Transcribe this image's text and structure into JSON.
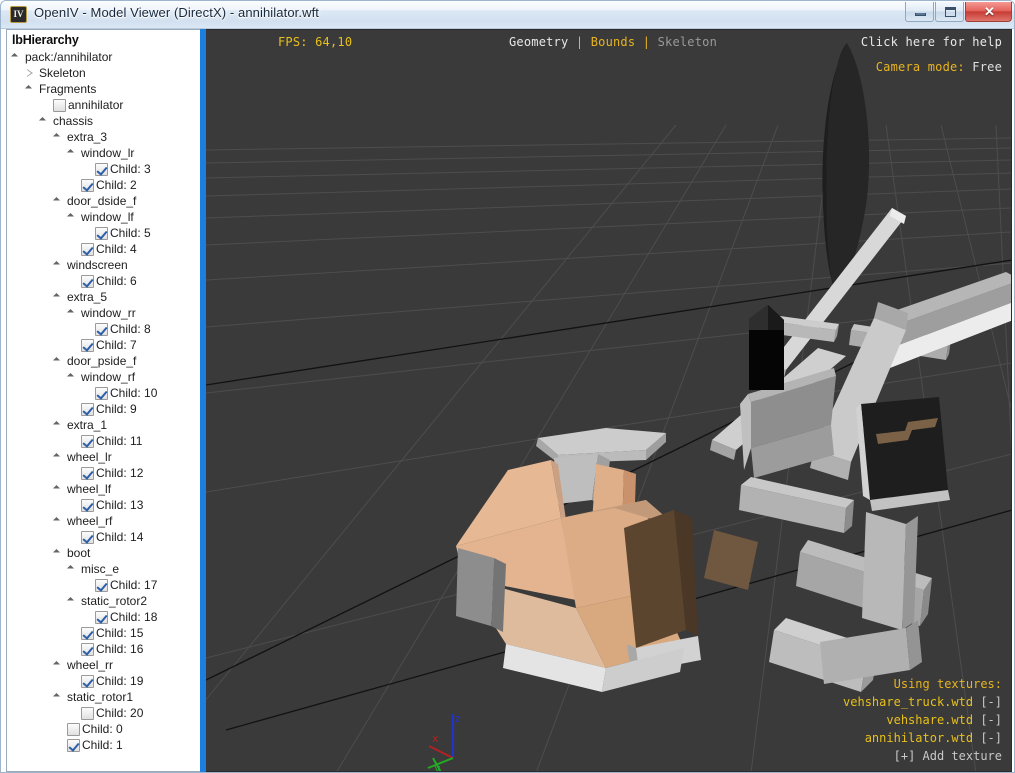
{
  "window": {
    "title": "OpenIV - Model Viewer (DirectX) - annihilator.wft",
    "icon": "openiv-app-icon",
    "minimize_label": "–",
    "maximize_label": "❐",
    "close_label": "✕"
  },
  "sidebar": {
    "header": "lbHierarchy",
    "items": [
      {
        "label": "pack:/annihilator",
        "depth": 0,
        "node": "open",
        "checkbox": null
      },
      {
        "label": "Skeleton",
        "depth": 1,
        "node": "closed",
        "checkbox": null
      },
      {
        "label": "Fragments",
        "depth": 1,
        "node": "open",
        "checkbox": null
      },
      {
        "label": "annihilator",
        "depth": 3,
        "node": "none",
        "checkbox": "unchecked"
      },
      {
        "label": "chassis",
        "depth": 2,
        "node": "open",
        "checkbox": null
      },
      {
        "label": "extra_3",
        "depth": 3,
        "node": "open",
        "checkbox": null
      },
      {
        "label": "window_lr",
        "depth": 4,
        "node": "open",
        "checkbox": null
      },
      {
        "label": "Child: 3",
        "depth": 6,
        "node": "none",
        "checkbox": "checked"
      },
      {
        "label": "Child: 2",
        "depth": 5,
        "node": "none",
        "checkbox": "checked"
      },
      {
        "label": "door_dside_f",
        "depth": 3,
        "node": "open",
        "checkbox": null
      },
      {
        "label": "window_lf",
        "depth": 4,
        "node": "open",
        "checkbox": null
      },
      {
        "label": "Child: 5",
        "depth": 6,
        "node": "none",
        "checkbox": "checked"
      },
      {
        "label": "Child: 4",
        "depth": 5,
        "node": "none",
        "checkbox": "checked"
      },
      {
        "label": "windscreen",
        "depth": 3,
        "node": "open",
        "checkbox": null
      },
      {
        "label": "Child: 6",
        "depth": 5,
        "node": "none",
        "checkbox": "checked"
      },
      {
        "label": "extra_5",
        "depth": 3,
        "node": "open",
        "checkbox": null
      },
      {
        "label": "window_rr",
        "depth": 4,
        "node": "open",
        "checkbox": null
      },
      {
        "label": "Child: 8",
        "depth": 6,
        "node": "none",
        "checkbox": "checked"
      },
      {
        "label": "Child: 7",
        "depth": 5,
        "node": "none",
        "checkbox": "checked"
      },
      {
        "label": "door_pside_f",
        "depth": 3,
        "node": "open",
        "checkbox": null
      },
      {
        "label": "window_rf",
        "depth": 4,
        "node": "open",
        "checkbox": null
      },
      {
        "label": "Child: 10",
        "depth": 6,
        "node": "none",
        "checkbox": "checked"
      },
      {
        "label": "Child: 9",
        "depth": 5,
        "node": "none",
        "checkbox": "checked"
      },
      {
        "label": "extra_1",
        "depth": 3,
        "node": "open",
        "checkbox": null
      },
      {
        "label": "Child: 11",
        "depth": 5,
        "node": "none",
        "checkbox": "checked"
      },
      {
        "label": "wheel_lr",
        "depth": 3,
        "node": "open",
        "checkbox": null
      },
      {
        "label": "Child: 12",
        "depth": 5,
        "node": "none",
        "checkbox": "checked"
      },
      {
        "label": "wheel_lf",
        "depth": 3,
        "node": "open",
        "checkbox": null
      },
      {
        "label": "Child: 13",
        "depth": 5,
        "node": "none",
        "checkbox": "checked"
      },
      {
        "label": "wheel_rf",
        "depth": 3,
        "node": "open",
        "checkbox": null
      },
      {
        "label": "Child: 14",
        "depth": 5,
        "node": "none",
        "checkbox": "checked"
      },
      {
        "label": "boot",
        "depth": 3,
        "node": "open",
        "checkbox": null
      },
      {
        "label": "misc_e",
        "depth": 4,
        "node": "open",
        "checkbox": null
      },
      {
        "label": "Child: 17",
        "depth": 6,
        "node": "none",
        "checkbox": "checked"
      },
      {
        "label": "static_rotor2",
        "depth": 4,
        "node": "open",
        "checkbox": null
      },
      {
        "label": "Child: 18",
        "depth": 6,
        "node": "none",
        "checkbox": "checked"
      },
      {
        "label": "Child: 15",
        "depth": 5,
        "node": "none",
        "checkbox": "checked"
      },
      {
        "label": "Child: 16",
        "depth": 5,
        "node": "none",
        "checkbox": "checked"
      },
      {
        "label": "wheel_rr",
        "depth": 3,
        "node": "open",
        "checkbox": null
      },
      {
        "label": "Child: 19",
        "depth": 5,
        "node": "none",
        "checkbox": "checked"
      },
      {
        "label": "static_rotor1",
        "depth": 3,
        "node": "open",
        "checkbox": null
      },
      {
        "label": "Child: 20",
        "depth": 5,
        "node": "none",
        "checkbox": "unchecked"
      },
      {
        "label": "Child: 0",
        "depth": 4,
        "node": "none",
        "checkbox": "unchecked"
      },
      {
        "label": "Child: 1",
        "depth": 4,
        "node": "none",
        "checkbox": "checked"
      }
    ]
  },
  "viewport": {
    "fps": "FPS: 64,10",
    "display_modes": {
      "geometry": "Geometry",
      "separator": "|",
      "bounds": "Bounds",
      "skeleton": "Skeleton"
    },
    "help_text": "Click here for help",
    "camera_mode_key": "Camera mode:",
    "camera_mode_value": "Free",
    "textures_header": "Using textures:",
    "textures": [
      {
        "name": "vehshare_truck.wtd",
        "toggle": "[-]"
      },
      {
        "name": "vehshare.wtd",
        "toggle": "[-]"
      },
      {
        "name": "annihilator.wtd",
        "toggle": "[-]"
      }
    ],
    "add_texture": "[+] Add texture",
    "axis_gizmo": {
      "x": "x",
      "y": "y",
      "z": "z"
    },
    "colors": {
      "background": "#3a3a3a",
      "grid": "#4d4d4d",
      "axis_line": "#121212",
      "accent_yellow": "#e8b420",
      "splitter_blue": "#1c7fe0",
      "axis_x": "#b22222",
      "axis_y": "#22aa22",
      "axis_z": "#2233cc"
    }
  }
}
